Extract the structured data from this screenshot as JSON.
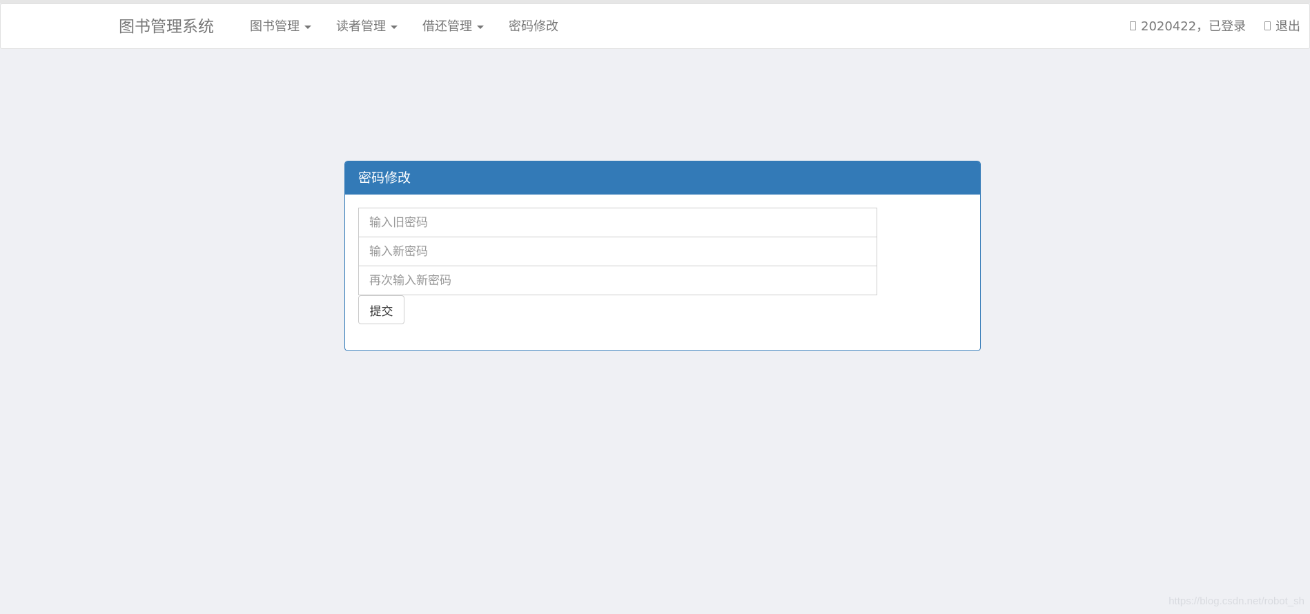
{
  "navbar": {
    "brand": "图书管理系统",
    "items": [
      {
        "label": "图书管理",
        "dropdown": true
      },
      {
        "label": "读者管理",
        "dropdown": true
      },
      {
        "label": "借还管理",
        "dropdown": true
      },
      {
        "label": "密码修改",
        "dropdown": false
      }
    ],
    "user_status": "2020422，已登录",
    "logout": "退出",
    "user_icon": "user-icon",
    "logout_icon": "logout-icon"
  },
  "panel": {
    "title": "密码修改",
    "old_password_placeholder": "输入旧密码",
    "new_password_placeholder": "输入新密码",
    "confirm_password_placeholder": "再次输入新密码",
    "submit_label": "提交"
  },
  "watermark": "https://blog.csdn.net/robot_sh",
  "colors": {
    "panel_primary": "#337ab7",
    "page_background": "#eff0f4"
  }
}
